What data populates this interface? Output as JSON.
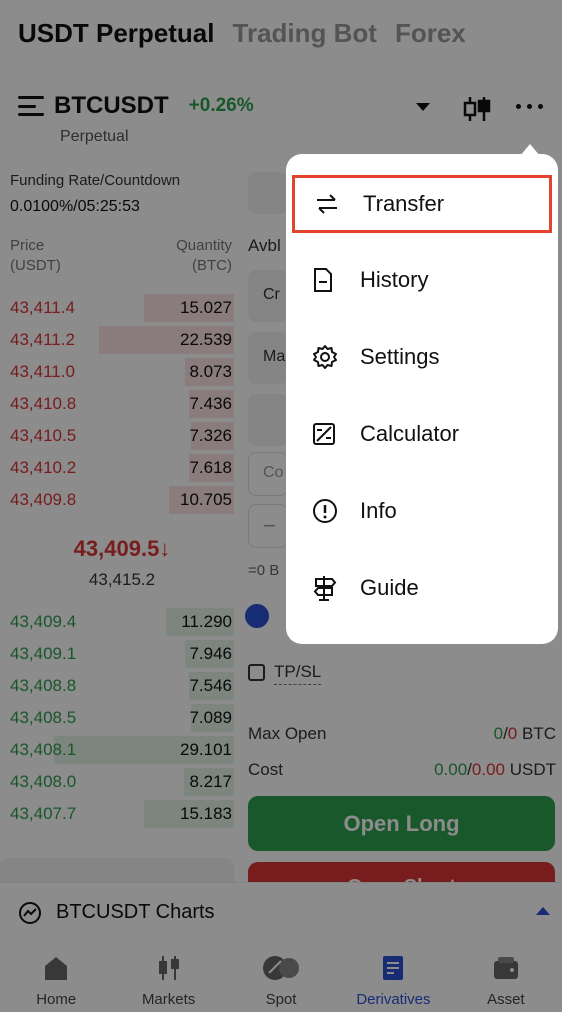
{
  "top_tabs": [
    {
      "label": "USDT Perpetual",
      "active": true
    },
    {
      "label": "Trading Bot",
      "active": false
    },
    {
      "label": "Forex",
      "active": false
    }
  ],
  "header": {
    "symbol": "BTCUSDT",
    "change": "+0.26%",
    "subtitle": "Perpetual"
  },
  "funding": {
    "label": "Funding Rate/Countdown",
    "value": "0.0100%/05:25:53"
  },
  "orderbook": {
    "price_header": [
      "Price",
      "(USDT)"
    ],
    "qty_header": [
      "Quantity",
      "(BTC)"
    ],
    "asks": [
      {
        "price": "43,411.4",
        "qty": "15.027",
        "depth": 0.5
      },
      {
        "price": "43,411.2",
        "qty": "22.539",
        "depth": 0.75
      },
      {
        "price": "43,411.0",
        "qty": "8.073",
        "depth": 0.27
      },
      {
        "price": "43,410.8",
        "qty": "7.436",
        "depth": 0.25
      },
      {
        "price": "43,410.5",
        "qty": "7.326",
        "depth": 0.24
      },
      {
        "price": "43,410.2",
        "qty": "7.618",
        "depth": 0.25
      },
      {
        "price": "43,409.8",
        "qty": "10.705",
        "depth": 0.36
      }
    ],
    "last_price": "43,409.5↓",
    "mark_price": "43,415.2",
    "bids": [
      {
        "price": "43,409.4",
        "qty": "11.290",
        "depth": 0.38
      },
      {
        "price": "43,409.1",
        "qty": "7.946",
        "depth": 0.27
      },
      {
        "price": "43,408.8",
        "qty": "7.546",
        "depth": 0.25
      },
      {
        "price": "43,408.5",
        "qty": "7.089",
        "depth": 0.24
      },
      {
        "price": "43,408.1",
        "qty": "29.101",
        "depth": 1.0
      },
      {
        "price": "43,408.0",
        "qty": "8.217",
        "depth": 0.28
      },
      {
        "price": "43,407.7",
        "qty": "15.183",
        "depth": 0.5
      }
    ]
  },
  "order_panel": {
    "avbl_label": "Avbl",
    "cross_label": "Cr",
    "market_label": "Ma",
    "cost_placeholder": "Co",
    "minus": "−",
    "zero_b": "=0 B",
    "tpsl_label": "TP/SL",
    "max_open_label": "Max Open",
    "max_open_long": "0",
    "max_open_short": "0",
    "max_open_unit": "BTC",
    "cost_label": "Cost",
    "cost_long": "0.00",
    "cost_short": "0.00",
    "cost_unit": "USDT",
    "slash": "/",
    "open_long": "Open Long",
    "open_short": "Open Short"
  },
  "charts_bar": {
    "label": "BTCUSDT Charts"
  },
  "bottom_nav": [
    {
      "label": "Home",
      "icon": "home-icon",
      "active": false
    },
    {
      "label": "Markets",
      "icon": "candlestick-icon",
      "active": false
    },
    {
      "label": "Spot",
      "icon": "spot-icon",
      "active": false
    },
    {
      "label": "Derivatives",
      "icon": "derivatives-icon",
      "active": true
    },
    {
      "label": "Asset",
      "icon": "wallet-icon",
      "active": false
    }
  ],
  "menu": {
    "items": [
      {
        "label": "Transfer",
        "icon": "transfer-icon",
        "highlighted": true
      },
      {
        "label": "History",
        "icon": "document-icon",
        "highlighted": false
      },
      {
        "label": "Settings",
        "icon": "gear-icon",
        "highlighted": false
      },
      {
        "label": "Calculator",
        "icon": "calculator-icon",
        "highlighted": false
      },
      {
        "label": "Info",
        "icon": "info-icon",
        "highlighted": false
      },
      {
        "label": "Guide",
        "icon": "signpost-icon",
        "highlighted": false
      }
    ]
  },
  "colors": {
    "buy": "#2e9e4e",
    "sell": "#d93636",
    "accent": "#2d4fd6",
    "highlight_border": "#e4432d"
  }
}
